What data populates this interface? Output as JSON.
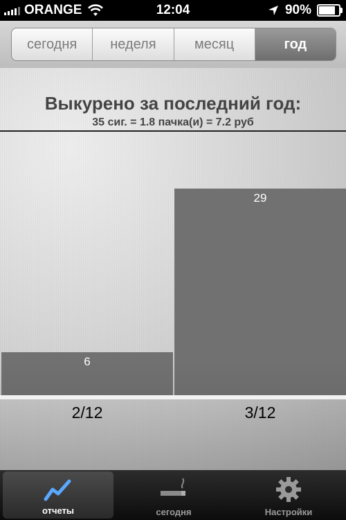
{
  "status_bar": {
    "carrier": "ORANGE",
    "time": "12:04",
    "battery": "90%",
    "battery_level": 0.9
  },
  "segments": [
    {
      "label": "сегодня",
      "selected": false
    },
    {
      "label": "неделя",
      "selected": false
    },
    {
      "label": "месяц",
      "selected": false
    },
    {
      "label": "год",
      "selected": true
    }
  ],
  "report": {
    "title": "Выкурено за последний год:",
    "subtitle": "35 сиг. = 1.8 пачка(и) = 7.2 руб"
  },
  "chart_data": {
    "type": "bar",
    "categories": [
      "2/12",
      "3/12"
    ],
    "values": [
      6,
      29
    ],
    "title": "",
    "xlabel": "",
    "ylabel": "",
    "ylim": [
      0,
      35
    ]
  },
  "tabbar": {
    "items": [
      {
        "label": "отчеты",
        "icon": "chart-line-icon",
        "active": true
      },
      {
        "label": "сегодня",
        "icon": "cigarette-icon",
        "active": false
      },
      {
        "label": "Настройки",
        "icon": "gear-icon",
        "active": false
      }
    ]
  },
  "colors": {
    "bar": "#717171",
    "selected_segment": "#7f7f7f",
    "tabbar": "#1a1a1a"
  }
}
